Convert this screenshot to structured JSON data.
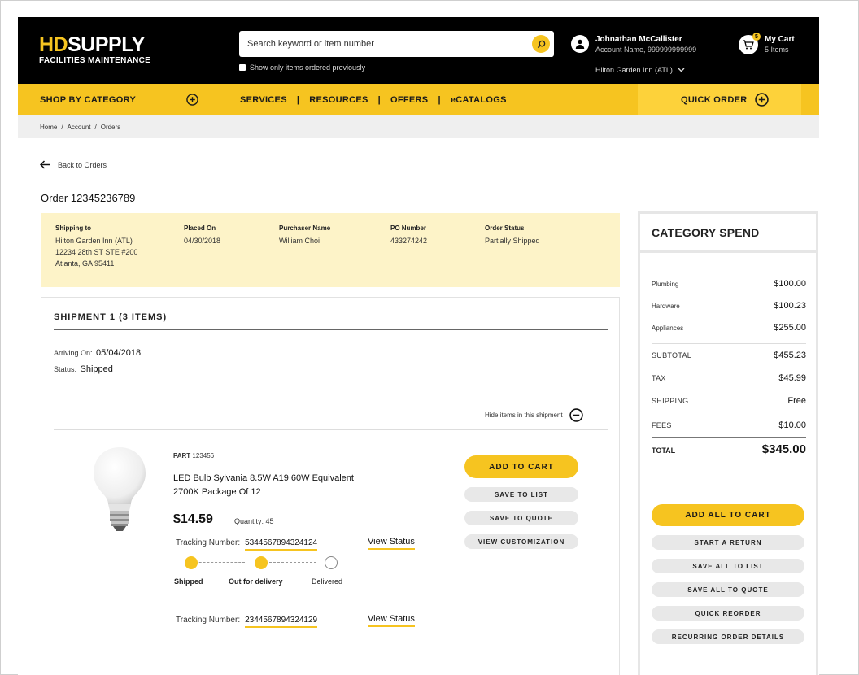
{
  "header": {
    "logo_hd": "HD",
    "logo_supply": "SUPPLY",
    "logo_sub": "FACILITIES MAINTENANCE",
    "search_placeholder": "Search keyword or item number",
    "prev_ordered_label": "Show only items ordered previously",
    "user_name": "Johnathan McCallister",
    "account_line": "Account Name, 999999999999",
    "location": "Hilton Garden Inn (ATL)",
    "cart_title": "My Cart",
    "cart_count_text": "5 Items",
    "cart_badge": "5"
  },
  "nav": {
    "shop_by_category": "SHOP BY CATEGORY",
    "links": [
      "SERVICES",
      "RESOURCES",
      "OFFERS",
      "eCATALOGS"
    ],
    "separator": "|",
    "quick_order": "QUICK ORDER"
  },
  "breadcrumb": [
    "Home",
    "Account",
    "Orders"
  ],
  "breadcrumb_sep": "/",
  "back_label": "Back to Orders",
  "order_title": "Order 12345236789",
  "order_info": {
    "shipping_label": "Shipping to",
    "shipping_lines": [
      "Hilton Garden Inn (ATL)",
      "12234 28th ST STE #200",
      "Atlanta, GA 95411"
    ],
    "placed_label": "Placed On",
    "placed_value": "04/30/2018",
    "purchaser_label": "Purchaser Name",
    "purchaser_value": "William Choi",
    "po_label": "PO Number",
    "po_value": "433274242",
    "status_label": "Order Status",
    "status_value": "Partially Shipped"
  },
  "shipment": {
    "title": "SHIPMENT 1 (3 ITEMS)",
    "arriving_label": "Arriving On:",
    "arriving_value": "05/04/2018",
    "status_label": "Status:",
    "status_value": "Shipped",
    "hide_label": "Hide items in this shipment",
    "item": {
      "part_label": "PART",
      "part_number": "123456",
      "name_line1": "LED Bulb Sylvania 8.5W A19 60W Equivalent",
      "name_line2": "2700K Package Of 12",
      "price": "$14.59",
      "quantity_label": "Quantity:",
      "quantity": "45",
      "tracking_label": "Tracking Number:",
      "tracking_1": "5344567894324124",
      "tracking_2": "2344567894324129",
      "view_status": "View Status",
      "progress_steps": [
        "Shipped",
        "Out for delivery",
        "Delivered"
      ],
      "progress_completed": 2
    },
    "buttons": {
      "add_to_cart": "ADD TO CART",
      "save_to_list": "SAVE TO LIST",
      "save_to_quote": "SAVE TO QUOTE",
      "view_customization": "VIEW CUSTOMIZATION"
    }
  },
  "category_spend": {
    "title": "CATEGORY SPEND",
    "categories": [
      {
        "label": "Plumbing",
        "value": "$100.00"
      },
      {
        "label": "Hardware",
        "value": "$100.23"
      },
      {
        "label": "Appliances",
        "value": "$255.00"
      }
    ],
    "subtotal_label": "SUBTOTAL",
    "subtotal": "$455.23",
    "tax_label": "TAX",
    "tax": "$45.99",
    "shipping_label": "SHIPPING",
    "shipping": "Free",
    "fees_label": "FEES",
    "fees": "$10.00",
    "total_label": "TOTAL",
    "total": "$345.00",
    "buttons": {
      "add_all": "ADD ALL TO CART",
      "start_return": "START A RETURN",
      "save_all_list": "SAVE ALL TO LIST",
      "save_all_quote": "SAVE ALL TO QUOTE",
      "quick_reorder": "QUICK REORDER",
      "recurring": "RECURRING ORDER DETAILS"
    }
  },
  "colors": {
    "brand_yellow": "#f6c420",
    "header_black": "#000000",
    "info_band": "#fdf3c8"
  }
}
